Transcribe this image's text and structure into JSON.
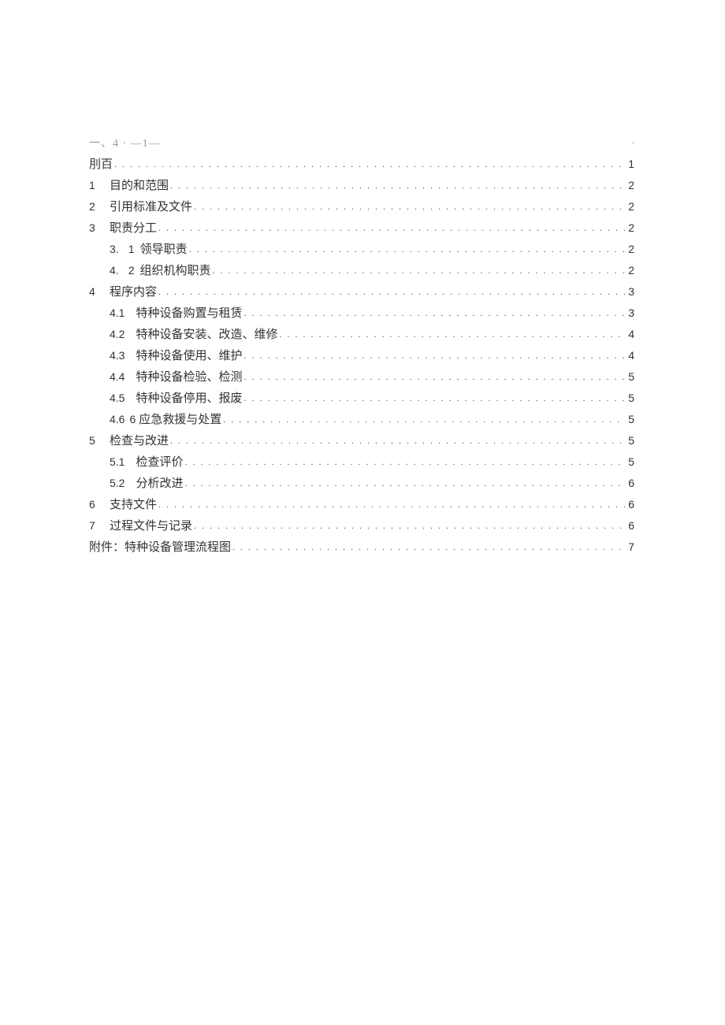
{
  "header": {
    "prefix": "一、4 · —1—",
    "dot": "."
  },
  "toc": [
    {
      "type": "top",
      "num": "",
      "title": "刖百",
      "page": "1"
    },
    {
      "type": "main",
      "num": "1",
      "title": "目的和范围",
      "page": "2"
    },
    {
      "type": "main",
      "num": "2",
      "title": "引用标准及文件",
      "page": "2"
    },
    {
      "type": "main",
      "num": "3",
      "title": "职责分工",
      "page": "2"
    },
    {
      "type": "sub2",
      "a": "3.",
      "b": "1",
      "title": "领导职责",
      "page": "2"
    },
    {
      "type": "sub2",
      "a": "4.",
      "b": "2",
      "title": "组织机构职责",
      "page": "2"
    },
    {
      "type": "main",
      "num": "4",
      "title": "程序内容",
      "page": "3"
    },
    {
      "type": "sub",
      "subnum": "4.1",
      "title": "特种设备购置与租赁",
      "page": "3"
    },
    {
      "type": "sub",
      "subnum": "4.2",
      "title": "特种设备安装、改造、维修",
      "page": "4"
    },
    {
      "type": "sub",
      "subnum": "4.3",
      "title": "特种设备使用、维护",
      "page": "4"
    },
    {
      "type": "sub",
      "subnum": "4.4",
      "title": "特种设备检验、检测",
      "page": "5"
    },
    {
      "type": "sub",
      "subnum": "4.5",
      "title": "特种设备停用、报废",
      "page": "5"
    },
    {
      "type": "sub3",
      "subnum": "4.6",
      "extra": "6",
      "title": "应急救援与处置",
      "page": "5"
    },
    {
      "type": "main",
      "num": "5",
      "title": "检查与改进",
      "page": "5"
    },
    {
      "type": "sub",
      "subnum": "5.1",
      "title": "检查评价",
      "page": "5"
    },
    {
      "type": "sub",
      "subnum": "5.2",
      "title": "分析改进",
      "page": "6"
    },
    {
      "type": "main",
      "num": "6",
      "title": "支持文件",
      "page": "6"
    },
    {
      "type": "main",
      "num": "7",
      "title": "过程文件与记录",
      "page": "6"
    },
    {
      "type": "top",
      "num": "",
      "title": "附件：特种设备管理流程图",
      "page": "7"
    }
  ]
}
